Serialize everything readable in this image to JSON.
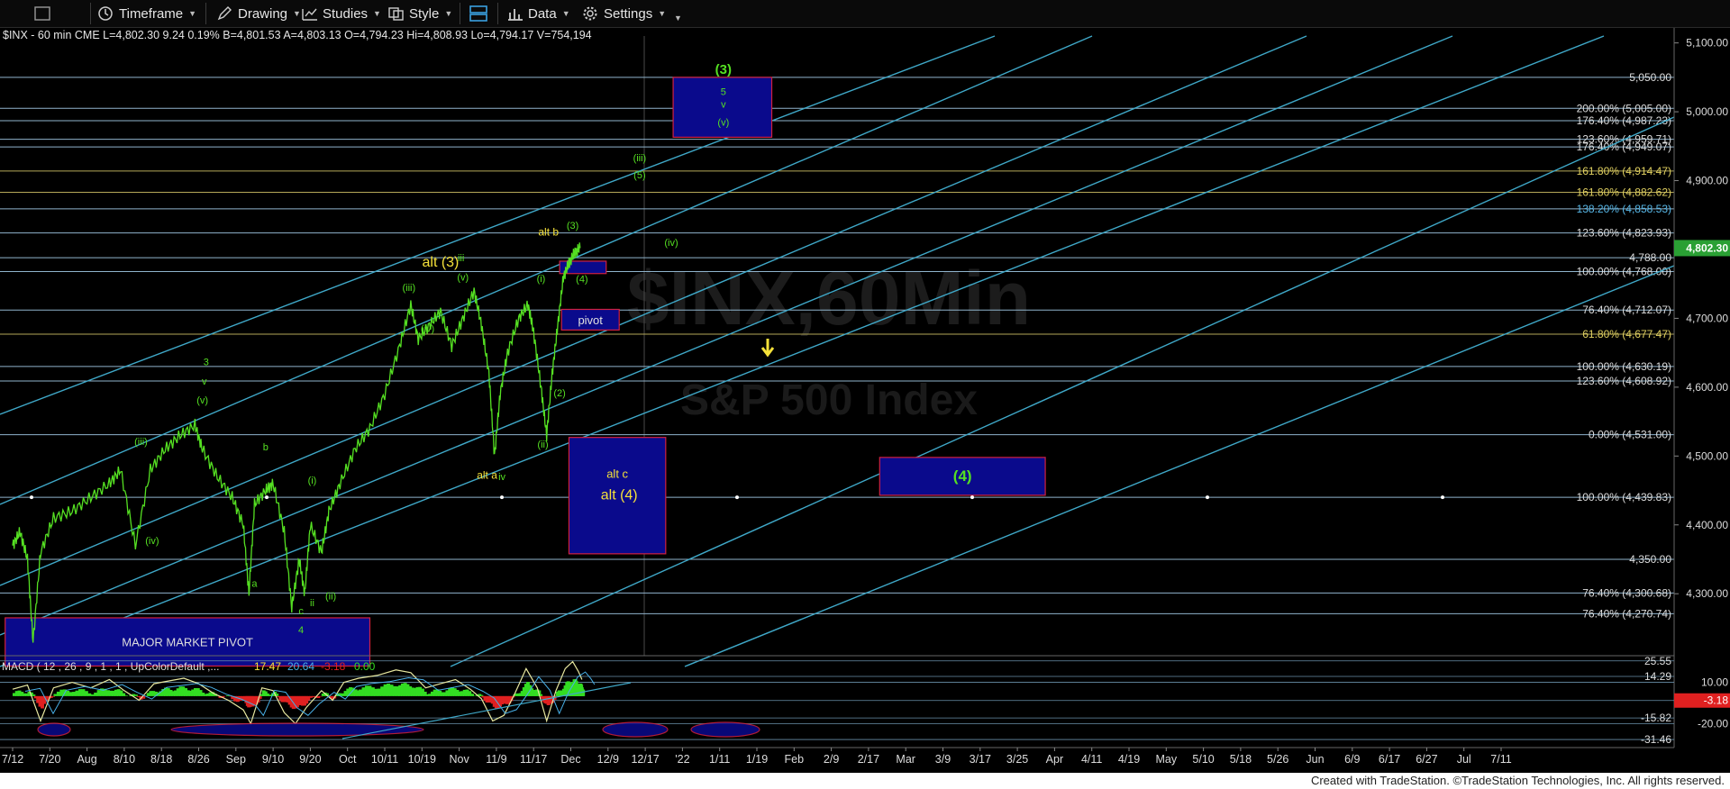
{
  "toolbar": {
    "items": [
      "Timeframe",
      "Drawing",
      "Studies",
      "Style",
      "Data",
      "Settings"
    ]
  },
  "symbol_bar": {
    "text": "$INX - 60 min  CME  L=4,802.30  9.24  0.19%  B=4,801.53  A=4,803.13  O=4,794.23  Hi=4,808.93  Lo=4,794.17  V=754,194"
  },
  "watermark": {
    "line1": "$INX,60Min",
    "line2": "S&P 500 Index"
  },
  "footer": {
    "text": "Created with TradeStation. ©TradeStation Technologies, Inc. All rights reserved."
  },
  "colors": {
    "price": "#55e022",
    "channel": "#3fa8c8",
    "fib_line": "#8fb3cc",
    "box_fill": "#0a0a8c",
    "box_border": "#d02040",
    "wave_green": "#55e022",
    "wave_yellow": "#f5e13a",
    "macd_fill_pos": "#33dd22",
    "macd_fill_neg": "#e02020",
    "macd_line": "#e8e8a0",
    "current_price_bg": "#2aa034"
  },
  "chart_data": [
    {
      "type": "line",
      "title": "$INX - 60 min",
      "y_ticks": [
        4300,
        4400,
        4500,
        4600,
        4700,
        4800,
        4900,
        5000,
        5100
      ],
      "y_tick_labels": [
        "4,300.00",
        "4,400.00",
        "4,500.00",
        "4,600.00",
        "4,700.00",
        "4,800.00",
        "4,900.00",
        "5,000.00",
        "5,100.00"
      ],
      "ylim": [
        4210,
        5110
      ],
      "x_labels": [
        "7/12",
        "7/20",
        "Aug",
        "8/10",
        "8/18",
        "8/26",
        "Sep",
        "9/10",
        "9/20",
        "Oct",
        "10/11",
        "10/19",
        "Nov",
        "11/9",
        "11/17",
        "Dec",
        "12/9",
        "12/17",
        "'22",
        "1/11",
        "1/19",
        "Feb",
        "2/9",
        "2/17",
        "Mar",
        "3/9",
        "3/17",
        "3/25",
        "Apr",
        "4/11",
        "4/19",
        "May",
        "5/10",
        "5/18",
        "5/26",
        "Jun",
        "6/9",
        "6/17",
        "6/27",
        "Jul",
        "7/11"
      ],
      "current_price": "4,802.30",
      "price_path": [
        [
          0.0,
          4370
        ],
        [
          0.2,
          4390
        ],
        [
          0.4,
          4350
        ],
        [
          0.55,
          4230
        ],
        [
          0.75,
          4360
        ],
        [
          1.1,
          4410
        ],
        [
          1.6,
          4420
        ],
        [
          2.1,
          4440
        ],
        [
          2.6,
          4460
        ],
        [
          2.9,
          4480
        ],
        [
          3.3,
          4370
        ],
        [
          3.7,
          4480
        ],
        [
          4.1,
          4510
        ],
        [
          4.5,
          4530
        ],
        [
          4.9,
          4545
        ],
        [
          5.1,
          4510
        ],
        [
          5.5,
          4470
        ],
        [
          5.9,
          4440
        ],
        [
          6.2,
          4400
        ],
        [
          6.35,
          4300
        ],
        [
          6.5,
          4430
        ],
        [
          6.8,
          4450
        ],
        [
          7.0,
          4460
        ],
        [
          7.3,
          4390
        ],
        [
          7.5,
          4280
        ],
        [
          7.7,
          4350
        ],
        [
          7.85,
          4300
        ],
        [
          8.0,
          4400
        ],
        [
          8.3,
          4360
        ],
        [
          8.5,
          4420
        ],
        [
          8.8,
          4460
        ],
        [
          9.2,
          4510
        ],
        [
          9.6,
          4540
        ],
        [
          10.0,
          4590
        ],
        [
          10.4,
          4660
        ],
        [
          10.7,
          4720
        ],
        [
          10.9,
          4670
        ],
        [
          11.2,
          4690
        ],
        [
          11.5,
          4710
        ],
        [
          11.8,
          4660
        ],
        [
          12.1,
          4700
        ],
        [
          12.4,
          4740
        ],
        [
          12.6,
          4690
        ],
        [
          12.8,
          4620
        ],
        [
          12.95,
          4500
        ],
        [
          13.1,
          4590
        ],
        [
          13.3,
          4650
        ],
        [
          13.6,
          4700
        ],
        [
          13.85,
          4720
        ],
        [
          14.0,
          4680
        ],
        [
          14.2,
          4600
        ],
        [
          14.35,
          4530
        ],
        [
          14.5,
          4620
        ],
        [
          14.65,
          4690
        ],
        [
          14.8,
          4760
        ],
        [
          14.95,
          4780
        ],
        [
          15.1,
          4795
        ],
        [
          15.25,
          4802
        ]
      ],
      "fib_levels": [
        {
          "label": "5,050.00",
          "value": 5050
        },
        {
          "label": "200.00% (5,005.00)",
          "value": 5005
        },
        {
          "label": "176.40% (4,987.23)",
          "value": 4987
        },
        {
          "label": "123.60% (4,959.71)",
          "value": 4960
        },
        {
          "label": "176.40% (4,949.07)",
          "value": 4949
        },
        {
          "label": "161.80% (4,914.47)",
          "value": 4914
        },
        {
          "label": "161.80% (4,882.62)",
          "value": 4883
        },
        {
          "label": "138.20% (4,858.53)",
          "value": 4859
        },
        {
          "label": "123.60% (4,823.93)",
          "value": 4824
        },
        {
          "label": "4,788.00",
          "value": 4788
        },
        {
          "label": "100.00% (4,768.00)",
          "value": 4768
        },
        {
          "label": "76.40% (4,712.07)",
          "value": 4712
        },
        {
          "label": "61.80% (4,677.47)",
          "value": 4677
        },
        {
          "label": "100.00% (4,630.19)",
          "value": 4630
        },
        {
          "label": "123.60% (4,608.92)",
          "value": 4609
        },
        {
          "label": "0.00% (4,531.00)",
          "value": 4531
        },
        {
          "label": "100.00% (4,439.83)",
          "value": 4440
        },
        {
          "label": "4,350.00",
          "value": 4350
        },
        {
          "label": "76.40% (4,300.68)",
          "value": 4301
        },
        {
          "label": "76.40% (4,270.74)",
          "value": 4271
        }
      ],
      "boxes": [
        {
          "label": "MAJOR MARKET PIVOT",
          "x0": -0.2,
          "x1": 9.6,
          "top": 4265,
          "bottom": 4195,
          "label_color": "#dddddd"
        },
        {
          "label": "pivot",
          "x0": 14.75,
          "x1": 16.3,
          "top": 4713,
          "bottom": 4683,
          "label_color": "#e0e0e0"
        },
        {
          "label": "",
          "x0": 14.7,
          "x1": 15.95,
          "top": 4783,
          "bottom": 4765,
          "label_color": "#e0e0e0"
        },
        {
          "label": "alt c",
          "x0": 14.95,
          "x1": 17.55,
          "top": 4527,
          "bottom": 4358,
          "label_color": "#f5e13a"
        },
        {
          "label": "(4)",
          "x0": 23.3,
          "x1": 27.75,
          "top": 4498,
          "bottom": 4443,
          "label_color": "#55e022"
        },
        {
          "label": "",
          "x0": 17.75,
          "x1": 20.4,
          "top": 5050,
          "bottom": 4963,
          "label_color": "#55e022"
        }
      ],
      "wave_labels_green": [
        {
          "text": "(3)",
          "x": 19.1,
          "y": 5055
        },
        {
          "text": "5",
          "x": 19.1,
          "y": 5024
        },
        {
          "text": "v",
          "x": 19.1,
          "y": 5006
        },
        {
          "text": "(v)",
          "x": 19.1,
          "y": 4980
        },
        {
          "text": "(iii)",
          "x": 16.85,
          "y": 4928
        },
        {
          "text": "(5)",
          "x": 16.85,
          "y": 4903
        },
        {
          "text": "(iv)",
          "x": 17.7,
          "y": 4805
        },
        {
          "text": "(3)",
          "x": 15.05,
          "y": 4830
        },
        {
          "text": "(4)",
          "x": 15.3,
          "y": 4752
        },
        {
          "text": "(i)",
          "x": 14.2,
          "y": 4753
        },
        {
          "text": "(2)",
          "x": 14.7,
          "y": 4587
        },
        {
          "text": "(ii)",
          "x": 14.25,
          "y": 4512
        },
        {
          "text": "iii",
          "x": 12.05,
          "y": 4783
        },
        {
          "text": "(v)",
          "x": 12.1,
          "y": 4755
        },
        {
          "text": "(iii)",
          "x": 10.65,
          "y": 4740
        },
        {
          "text": "(iv)",
          "x": 11.15,
          "y": 4680
        },
        {
          "text": "iv",
          "x": 13.15,
          "y": 4465
        },
        {
          "text": "3",
          "x": 5.2,
          "y": 4632
        },
        {
          "text": "v",
          "x": 5.15,
          "y": 4604
        },
        {
          "text": "(v)",
          "x": 5.1,
          "y": 4576
        },
        {
          "text": "(iii)",
          "x": 3.45,
          "y": 4516
        },
        {
          "text": "(iv)",
          "x": 3.75,
          "y": 4372
        },
        {
          "text": "b",
          "x": 6.8,
          "y": 4508
        },
        {
          "text": "a",
          "x": 6.5,
          "y": 4310
        },
        {
          "text": "(i)",
          "x": 8.05,
          "y": 4460
        },
        {
          "text": "(ii)",
          "x": 8.55,
          "y": 4292
        },
        {
          "text": "c",
          "x": 7.75,
          "y": 4270
        },
        {
          "text": "ii",
          "x": 8.05,
          "y": 4282
        },
        {
          "text": "4",
          "x": 7.75,
          "y": 4243
        }
      ],
      "wave_labels_yellow": [
        {
          "text": "alt (3)",
          "x": 11.5,
          "y": 4775
        },
        {
          "text": "alt b",
          "x": 14.4,
          "y": 4820
        },
        {
          "text": "alt a",
          "x": 12.75,
          "y": 4467
        },
        {
          "text": "alt (4)",
          "x": 16.3,
          "y": 4437
        }
      ]
    },
    {
      "type": "line",
      "title": "MACD ( 12 , 26 , 9 , 1 , 1 , UpColorDefault ,... ",
      "legend_values": [
        "17.47",
        "20.64",
        "-3.18",
        "0.00"
      ],
      "legend_colors": [
        "#f5e13a",
        "#48b0e8",
        "#e02020",
        "#33dd22"
      ],
      "y_tick_labels": [
        "25.55",
        "14.29",
        "10.00",
        "-3.18",
        "-15.82",
        "-20.00",
        "-31.46"
      ],
      "y_ticks": [
        25.55,
        14.29,
        10,
        -3.18,
        -15.82,
        -20,
        -31.46
      ],
      "ylim": [
        -36,
        28
      ],
      "macd_path": [
        [
          0.0,
          5
        ],
        [
          0.4,
          8
        ],
        [
          0.75,
          -18
        ],
        [
          1.1,
          6
        ],
        [
          1.6,
          10
        ],
        [
          2.1,
          6
        ],
        [
          2.6,
          12
        ],
        [
          3.0,
          4
        ],
        [
          3.4,
          -3
        ],
        [
          3.8,
          9
        ],
        [
          4.2,
          11
        ],
        [
          4.6,
          13
        ],
        [
          5.0,
          9
        ],
        [
          5.4,
          2
        ],
        [
          5.8,
          -3
        ],
        [
          6.2,
          -10
        ],
        [
          6.4,
          -20
        ],
        [
          6.7,
          6
        ],
        [
          7.0,
          4
        ],
        [
          7.3,
          -12
        ],
        [
          7.6,
          -20
        ],
        [
          7.9,
          -8
        ],
        [
          8.3,
          4
        ],
        [
          8.6,
          -3
        ],
        [
          8.9,
          10
        ],
        [
          9.3,
          13
        ],
        [
          9.8,
          15
        ],
        [
          10.3,
          19
        ],
        [
          10.7,
          17
        ],
        [
          11.1,
          6
        ],
        [
          11.5,
          9
        ],
        [
          11.9,
          12
        ],
        [
          12.3,
          5
        ],
        [
          12.6,
          -2
        ],
        [
          12.9,
          -18
        ],
        [
          13.2,
          -14
        ],
        [
          13.5,
          2
        ],
        [
          13.8,
          20
        ],
        [
          14.1,
          6
        ],
        [
          14.35,
          -18
        ],
        [
          14.6,
          4
        ],
        [
          14.85,
          20
        ],
        [
          15.05,
          25
        ],
        [
          15.2,
          18
        ],
        [
          15.3,
          12
        ]
      ]
    }
  ]
}
